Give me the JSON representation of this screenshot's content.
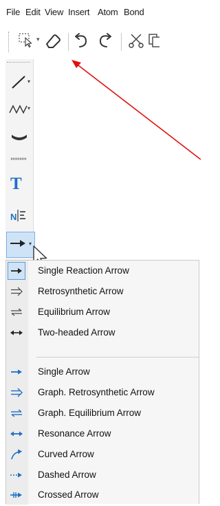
{
  "menu": {
    "file": "File",
    "edit": "Edit",
    "view": "View",
    "insert": "Insert",
    "atom": "Atom",
    "bond": "Bond"
  },
  "toolbar": {
    "tools": [
      "select-icon",
      "eraser-icon",
      "undo-icon",
      "redo-icon",
      "cut-icon",
      "copy-icon"
    ]
  },
  "left_panel": {
    "tools": [
      "single-bond-icon",
      "chain-icon",
      "ring-icon",
      "dashed-line-icon",
      "text-icon",
      "atom-label-icon",
      "arrow-icon"
    ],
    "text_tool_glyph": "T"
  },
  "annotation": {
    "color": "#e01010"
  },
  "dropdown": {
    "items": [
      {
        "label": "Single Reaction Arrow",
        "icon": "single-reaction-arrow-icon",
        "selected": true
      },
      {
        "label": "Retrosynthetic Arrow",
        "icon": "retrosynthetic-arrow-icon",
        "selected": false
      },
      {
        "label": "Equilibrium Arrow",
        "icon": "equilibrium-arrow-icon",
        "selected": false
      },
      {
        "label": "Two-headed Arrow",
        "icon": "two-headed-arrow-icon",
        "selected": false
      },
      {
        "label": "Single Arrow",
        "icon": "single-arrow-icon",
        "selected": false
      },
      {
        "label": "Graph. Retrosynthetic Arrow",
        "icon": "graph-retrosynthetic-arrow-icon",
        "selected": false
      },
      {
        "label": "Graph. Equilibrium Arrow",
        "icon": "graph-equilibrium-arrow-icon",
        "selected": false
      },
      {
        "label": "Resonance Arrow",
        "icon": "resonance-arrow-icon",
        "selected": false
      },
      {
        "label": "Curved Arrow",
        "icon": "curved-arrow-icon",
        "selected": false
      },
      {
        "label": "Dashed Arrow",
        "icon": "dashed-arrow-icon",
        "selected": false
      },
      {
        "label": "Crossed Arrow",
        "icon": "crossed-arrow-icon",
        "selected": false
      }
    ],
    "accent": "#1f6fc4"
  }
}
